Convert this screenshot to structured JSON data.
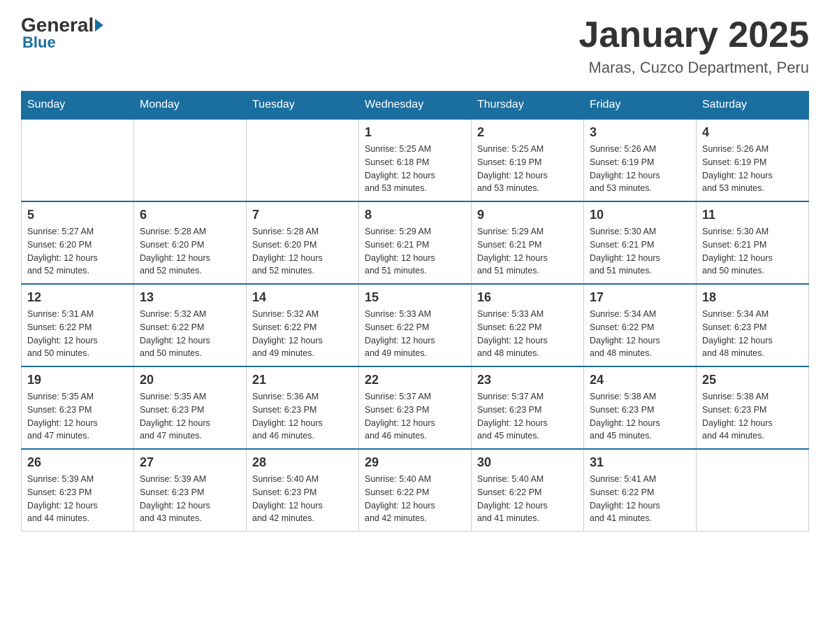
{
  "logo": {
    "general": "General",
    "blue": "Blue"
  },
  "title": "January 2025",
  "location": "Maras, Cuzco Department, Peru",
  "days_of_week": [
    "Sunday",
    "Monday",
    "Tuesday",
    "Wednesday",
    "Thursday",
    "Friday",
    "Saturday"
  ],
  "weeks": [
    [
      {
        "day": "",
        "info": ""
      },
      {
        "day": "",
        "info": ""
      },
      {
        "day": "",
        "info": ""
      },
      {
        "day": "1",
        "info": "Sunrise: 5:25 AM\nSunset: 6:18 PM\nDaylight: 12 hours\nand 53 minutes."
      },
      {
        "day": "2",
        "info": "Sunrise: 5:25 AM\nSunset: 6:19 PM\nDaylight: 12 hours\nand 53 minutes."
      },
      {
        "day": "3",
        "info": "Sunrise: 5:26 AM\nSunset: 6:19 PM\nDaylight: 12 hours\nand 53 minutes."
      },
      {
        "day": "4",
        "info": "Sunrise: 5:26 AM\nSunset: 6:19 PM\nDaylight: 12 hours\nand 53 minutes."
      }
    ],
    [
      {
        "day": "5",
        "info": "Sunrise: 5:27 AM\nSunset: 6:20 PM\nDaylight: 12 hours\nand 52 minutes."
      },
      {
        "day": "6",
        "info": "Sunrise: 5:28 AM\nSunset: 6:20 PM\nDaylight: 12 hours\nand 52 minutes."
      },
      {
        "day": "7",
        "info": "Sunrise: 5:28 AM\nSunset: 6:20 PM\nDaylight: 12 hours\nand 52 minutes."
      },
      {
        "day": "8",
        "info": "Sunrise: 5:29 AM\nSunset: 6:21 PM\nDaylight: 12 hours\nand 51 minutes."
      },
      {
        "day": "9",
        "info": "Sunrise: 5:29 AM\nSunset: 6:21 PM\nDaylight: 12 hours\nand 51 minutes."
      },
      {
        "day": "10",
        "info": "Sunrise: 5:30 AM\nSunset: 6:21 PM\nDaylight: 12 hours\nand 51 minutes."
      },
      {
        "day": "11",
        "info": "Sunrise: 5:30 AM\nSunset: 6:21 PM\nDaylight: 12 hours\nand 50 minutes."
      }
    ],
    [
      {
        "day": "12",
        "info": "Sunrise: 5:31 AM\nSunset: 6:22 PM\nDaylight: 12 hours\nand 50 minutes."
      },
      {
        "day": "13",
        "info": "Sunrise: 5:32 AM\nSunset: 6:22 PM\nDaylight: 12 hours\nand 50 minutes."
      },
      {
        "day": "14",
        "info": "Sunrise: 5:32 AM\nSunset: 6:22 PM\nDaylight: 12 hours\nand 49 minutes."
      },
      {
        "day": "15",
        "info": "Sunrise: 5:33 AM\nSunset: 6:22 PM\nDaylight: 12 hours\nand 49 minutes."
      },
      {
        "day": "16",
        "info": "Sunrise: 5:33 AM\nSunset: 6:22 PM\nDaylight: 12 hours\nand 48 minutes."
      },
      {
        "day": "17",
        "info": "Sunrise: 5:34 AM\nSunset: 6:22 PM\nDaylight: 12 hours\nand 48 minutes."
      },
      {
        "day": "18",
        "info": "Sunrise: 5:34 AM\nSunset: 6:23 PM\nDaylight: 12 hours\nand 48 minutes."
      }
    ],
    [
      {
        "day": "19",
        "info": "Sunrise: 5:35 AM\nSunset: 6:23 PM\nDaylight: 12 hours\nand 47 minutes."
      },
      {
        "day": "20",
        "info": "Sunrise: 5:35 AM\nSunset: 6:23 PM\nDaylight: 12 hours\nand 47 minutes."
      },
      {
        "day": "21",
        "info": "Sunrise: 5:36 AM\nSunset: 6:23 PM\nDaylight: 12 hours\nand 46 minutes."
      },
      {
        "day": "22",
        "info": "Sunrise: 5:37 AM\nSunset: 6:23 PM\nDaylight: 12 hours\nand 46 minutes."
      },
      {
        "day": "23",
        "info": "Sunrise: 5:37 AM\nSunset: 6:23 PM\nDaylight: 12 hours\nand 45 minutes."
      },
      {
        "day": "24",
        "info": "Sunrise: 5:38 AM\nSunset: 6:23 PM\nDaylight: 12 hours\nand 45 minutes."
      },
      {
        "day": "25",
        "info": "Sunrise: 5:38 AM\nSunset: 6:23 PM\nDaylight: 12 hours\nand 44 minutes."
      }
    ],
    [
      {
        "day": "26",
        "info": "Sunrise: 5:39 AM\nSunset: 6:23 PM\nDaylight: 12 hours\nand 44 minutes."
      },
      {
        "day": "27",
        "info": "Sunrise: 5:39 AM\nSunset: 6:23 PM\nDaylight: 12 hours\nand 43 minutes."
      },
      {
        "day": "28",
        "info": "Sunrise: 5:40 AM\nSunset: 6:23 PM\nDaylight: 12 hours\nand 42 minutes."
      },
      {
        "day": "29",
        "info": "Sunrise: 5:40 AM\nSunset: 6:22 PM\nDaylight: 12 hours\nand 42 minutes."
      },
      {
        "day": "30",
        "info": "Sunrise: 5:40 AM\nSunset: 6:22 PM\nDaylight: 12 hours\nand 41 minutes."
      },
      {
        "day": "31",
        "info": "Sunrise: 5:41 AM\nSunset: 6:22 PM\nDaylight: 12 hours\nand 41 minutes."
      },
      {
        "day": "",
        "info": ""
      }
    ]
  ]
}
